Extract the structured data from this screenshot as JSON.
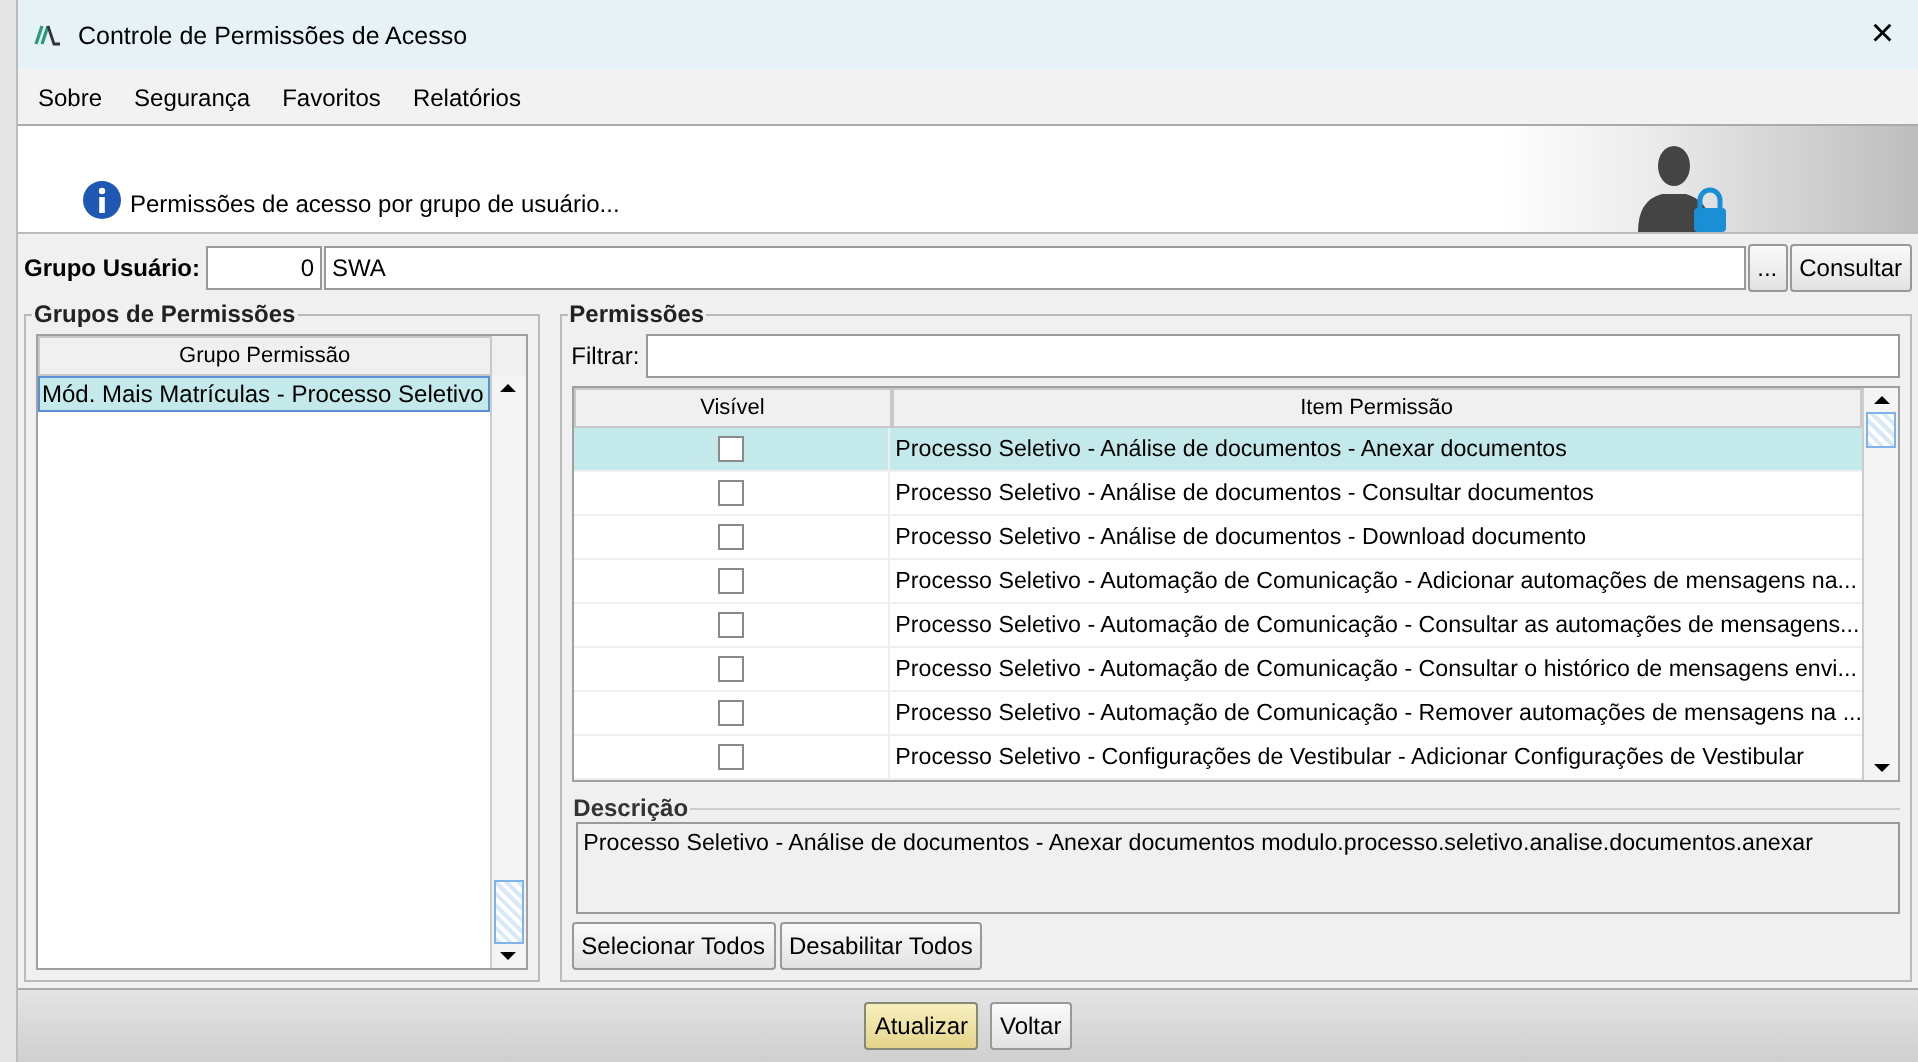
{
  "window": {
    "title": "Controle de Permissões de Acesso",
    "close": "×"
  },
  "menu": [
    "Sobre",
    "Segurança",
    "Favoritos",
    "Relatórios"
  ],
  "banner": {
    "message": "Permissões de acesso por grupo de usuário..."
  },
  "grupo_usuario": {
    "label": "Grupo Usuário:",
    "code": "0",
    "name": "SWA",
    "browse": "...",
    "query": "Consultar"
  },
  "grupos": {
    "title": "Grupos de Permissões",
    "column": "Grupo Permissão",
    "items": [
      {
        "label": "Mód. Mais Matrículas - Processo Seletivo",
        "selected": true
      }
    ]
  },
  "permissoes": {
    "title": "Permissões",
    "filter_label": "Filtrar:",
    "columns": [
      "Visível",
      "Item Permissão"
    ],
    "rows": [
      {
        "checked": false,
        "selected": true,
        "item": "Processo Seletivo - Análise de documentos - Anexar documentos"
      },
      {
        "checked": false,
        "selected": false,
        "item": "Processo Seletivo - Análise de documentos - Consultar documentos"
      },
      {
        "checked": false,
        "selected": false,
        "item": "Processo Seletivo - Análise de documentos - Download documento"
      },
      {
        "checked": false,
        "selected": false,
        "item": "Processo Seletivo - Automação de Comunicação - Adicionar automações de mensagens na..."
      },
      {
        "checked": false,
        "selected": false,
        "item": "Processo Seletivo - Automação de Comunicação - Consultar as automações de mensagens..."
      },
      {
        "checked": false,
        "selected": false,
        "item": "Processo Seletivo - Automação de Comunicação - Consultar o histórico de mensagens envi..."
      },
      {
        "checked": false,
        "selected": false,
        "item": "Processo Seletivo - Automação de Comunicação - Remover automações de mensagens na ..."
      },
      {
        "checked": false,
        "selected": false,
        "item": "Processo Seletivo - Configurações de Vestibular - Adicionar Configurações de Vestibular"
      }
    ],
    "description_label": "Descrição",
    "description": "Processo Seletivo - Análise de documentos - Anexar documentos modulo.processo.seletivo.analise.documentos.anexar",
    "buttons": [
      "Selecionar Todos",
      "Desabilitar Todos"
    ]
  },
  "footer_buttons": [
    {
      "label": "Atualizar",
      "kind": "primary"
    },
    {
      "label": "Voltar",
      "kind": "normal"
    }
  ]
}
